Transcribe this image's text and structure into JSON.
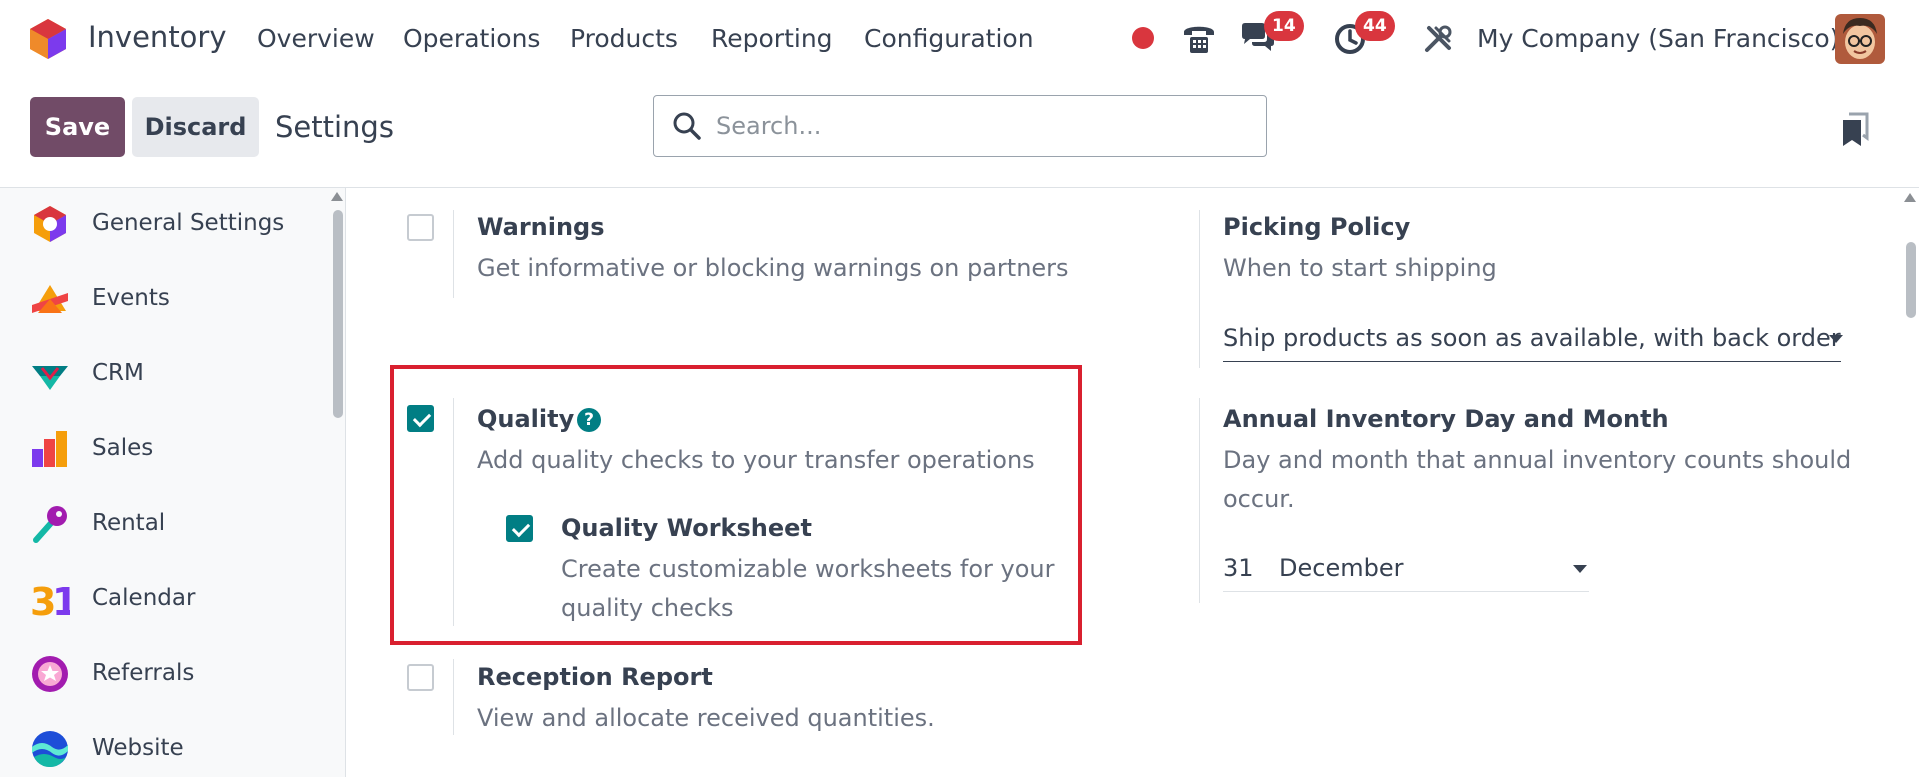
{
  "navbar": {
    "app_name": "Inventory",
    "menus": [
      "Overview",
      "Operations",
      "Products",
      "Reporting",
      "Configuration"
    ],
    "messages_count": "14",
    "activities_count": "44",
    "company": "My Company (San Francisco)"
  },
  "control_panel": {
    "save_label": "Save",
    "discard_label": "Discard",
    "title": "Settings",
    "search_placeholder": "Search..."
  },
  "sidebar": {
    "items": [
      {
        "label": "General Settings",
        "icon": "general-settings-icon"
      },
      {
        "label": "Events",
        "icon": "events-icon"
      },
      {
        "label": "CRM",
        "icon": "crm-icon"
      },
      {
        "label": "Sales",
        "icon": "sales-icon"
      },
      {
        "label": "Rental",
        "icon": "rental-icon"
      },
      {
        "label": "Calendar",
        "icon": "calendar-icon"
      },
      {
        "label": "Referrals",
        "icon": "referrals-icon"
      },
      {
        "label": "Website",
        "icon": "website-icon"
      }
    ]
  },
  "settings": {
    "warnings": {
      "title": "Warnings",
      "desc": "Get informative or blocking warnings on partners",
      "checked": false
    },
    "picking_policy": {
      "title": "Picking Policy",
      "desc": "When to start shipping",
      "value": "Ship products as soon as available, with back order"
    },
    "quality": {
      "title": "Quality",
      "desc": "Add quality checks to your transfer operations",
      "checked": true
    },
    "quality_worksheet": {
      "title": "Quality Worksheet",
      "desc_line1": "Create customizable worksheets for your",
      "desc_line2": "quality checks",
      "checked": true
    },
    "annual_inventory": {
      "title": "Annual Inventory Day and Month",
      "desc_line1": "Day and month that annual inventory counts should",
      "desc_line2": "occur.",
      "day": "31",
      "month": "December"
    },
    "reception_report": {
      "title": "Reception Report",
      "desc": "View and allocate received quantities.",
      "checked": false
    }
  },
  "colors": {
    "primary": "#714b67",
    "accent": "#017e84",
    "badge": "#d9363e",
    "highlight": "#d9202f"
  }
}
